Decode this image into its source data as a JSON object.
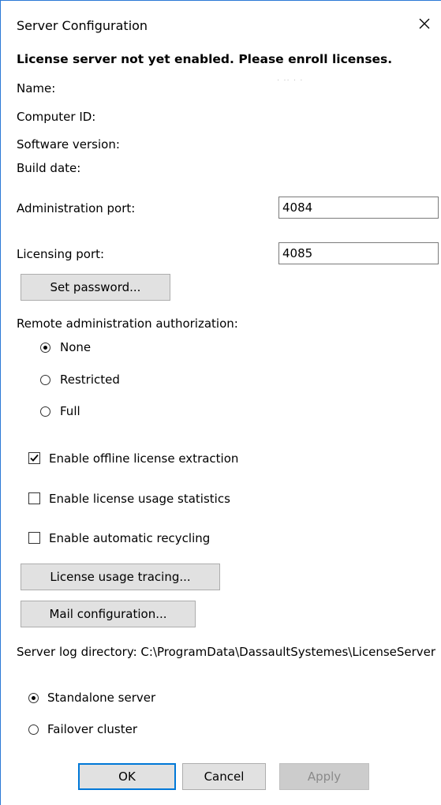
{
  "window": {
    "title": "Server Configuration",
    "close_glyph": "✕"
  },
  "status_heading": "License server not yet enabled. Please enroll licenses.",
  "info": {
    "name_label": "Name:",
    "name_value": "· ·· · ·",
    "computer_id_label": "Computer ID:",
    "software_version_label": "Software version:",
    "build_date_label": "Build date:"
  },
  "ports": {
    "admin_label": "Administration port:",
    "admin_value": "4084",
    "licensing_label": "Licensing port:",
    "licensing_value": "4085"
  },
  "set_password_button": "Set password...",
  "remote_admin": {
    "label": "Remote administration authorization:",
    "options": [
      {
        "label": "None",
        "selected": true
      },
      {
        "label": "Restricted",
        "selected": false
      },
      {
        "label": "Full",
        "selected": false
      }
    ]
  },
  "checkboxes": [
    {
      "label": "Enable offline license extraction",
      "checked": true
    },
    {
      "label": "Enable license usage statistics",
      "checked": false
    },
    {
      "label": "Enable automatic recycling",
      "checked": false
    }
  ],
  "license_usage_tracing_button": "License usage tracing...",
  "mail_configuration_button": "Mail configuration...",
  "server_log_directory": "Server log directory: C:\\ProgramData\\DassaultSystemes\\LicenseServer",
  "server_mode": {
    "options": [
      {
        "label": "Standalone server",
        "selected": true
      },
      {
        "label": "Failover cluster",
        "selected": false
      }
    ]
  },
  "footer": {
    "ok": "OK",
    "cancel": "Cancel",
    "apply": "Apply"
  },
  "icons": {
    "close": "close-icon",
    "check": "checkmark-icon"
  }
}
